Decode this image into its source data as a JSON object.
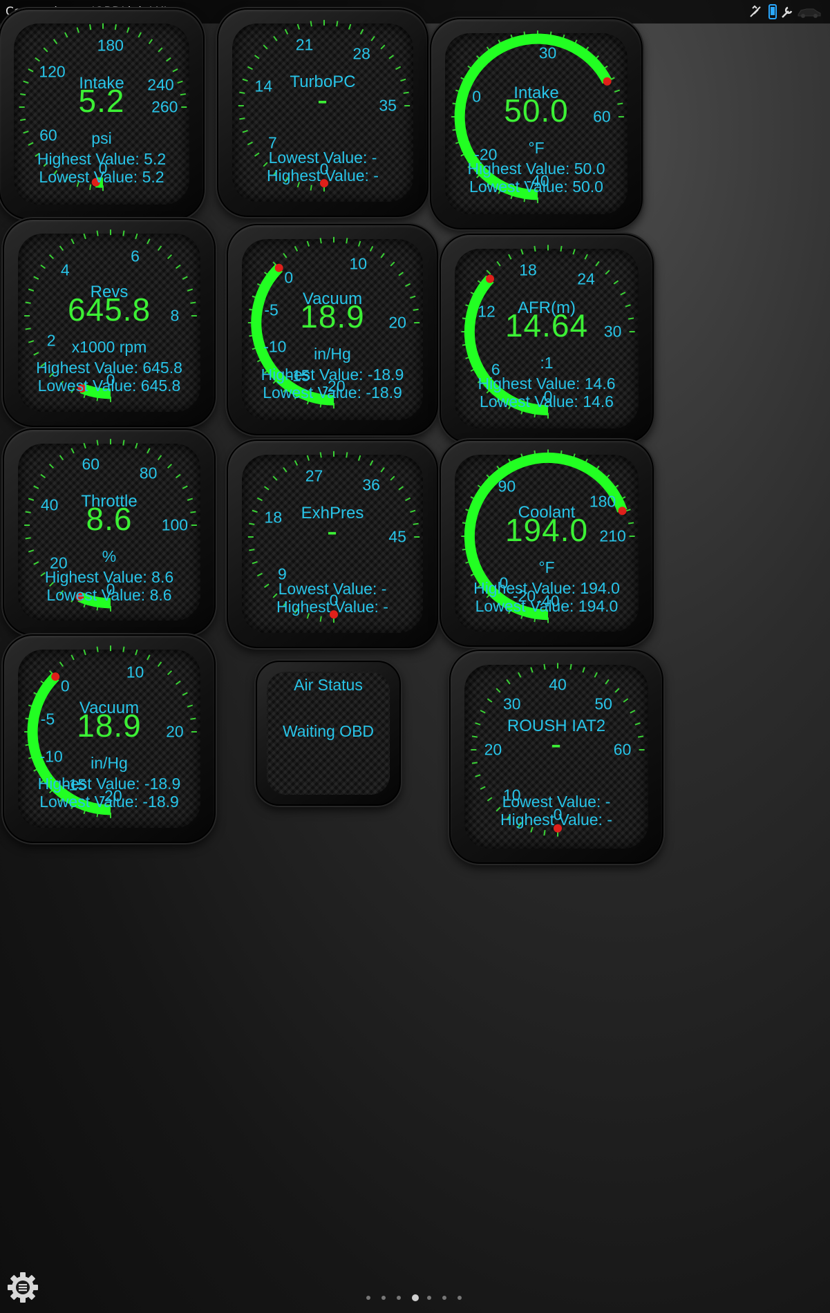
{
  "status_bar": {
    "text": "Connecting to 'OBDLink LX'",
    "icons": [
      "gps-icon",
      "phone-icon",
      "wrench-icon",
      "car-icon"
    ]
  },
  "gauges": [
    {
      "id": "intake-boost",
      "title": "Intake",
      "value": "5.2",
      "unit": "psi",
      "min": 0,
      "max": 260,
      "ticks": [
        "0",
        "60",
        "120",
        "180",
        "240",
        "260"
      ],
      "tick_values": [
        0,
        60,
        120,
        180,
        240,
        260
      ],
      "fill": 0.02,
      "stat1": "Highest Value: 5.2",
      "stat2": "Lowest Value: 5.2"
    },
    {
      "id": "turbopc",
      "title": "TurboPC",
      "value": "-",
      "unit": "",
      "min": 0,
      "max": 35,
      "ticks": [
        "0",
        "7",
        "14",
        "21",
        "28",
        "35"
      ],
      "tick_values": [
        0,
        7,
        14,
        21,
        28,
        35
      ],
      "fill": 0,
      "stat1": "Lowest Value: -",
      "stat2": "Highest Value: -"
    },
    {
      "id": "intake-temp",
      "title": "Intake",
      "value": "50.0",
      "unit": "°F",
      "min": -40,
      "max": 60,
      "ticks": [
        "-40",
        "-20",
        "0",
        "30",
        "60"
      ],
      "tick_values": [
        -40,
        -20,
        0,
        30,
        60
      ],
      "fill": 0.9,
      "stat1": "Highest Value: 50.0",
      "stat2": "Lowest Value: 50.0"
    },
    {
      "id": "revs",
      "title": "Revs",
      "value": "645.8",
      "unit": "x1000 rpm",
      "min": 0,
      "max": 8,
      "ticks": [
        "0",
        "2",
        "4",
        "6",
        "8"
      ],
      "tick_values": [
        0,
        2,
        4,
        6,
        8
      ],
      "fill": 0.08,
      "stat1": "Highest Value: 645.8",
      "stat2": "Lowest Value: 645.8"
    },
    {
      "id": "vacuum-1",
      "title": "Vacuum",
      "value": "18.9",
      "unit": "in/Hg",
      "min": -20,
      "max": 20,
      "ticks": [
        "-20",
        "-15",
        "-10",
        "-5",
        "0",
        "10",
        "20"
      ],
      "tick_values": [
        -20,
        -15,
        -10,
        -5,
        0,
        10,
        20
      ],
      "fill": 0.5,
      "stat1": "Highest Value: -18.9",
      "stat2": "Lowest Value: -18.9"
    },
    {
      "id": "afr",
      "title": "AFR(m)",
      "value": "14.64",
      "unit": ":1",
      "min": 0,
      "max": 30,
      "ticks": [
        "0",
        "6",
        "12",
        "18",
        "24",
        "30"
      ],
      "tick_values": [
        0,
        6,
        12,
        18,
        24,
        30
      ],
      "fill": 0.49,
      "stat1": "Highest Value: 14.6",
      "stat2": "Lowest Value: 14.6"
    },
    {
      "id": "throttle",
      "title": "Throttle",
      "value": "8.6",
      "unit": "%",
      "min": 0,
      "max": 100,
      "ticks": [
        "0",
        "20",
        "40",
        "60",
        "80",
        "100"
      ],
      "tick_values": [
        0,
        20,
        40,
        60,
        80,
        100
      ],
      "fill": 0.086,
      "stat1": "Highest Value: 8.6",
      "stat2": "Lowest Value: 8.6"
    },
    {
      "id": "exhpres",
      "title": "ExhPres",
      "value": "-",
      "unit": "",
      "min": 0,
      "max": 45,
      "ticks": [
        "0",
        "9",
        "18",
        "27",
        "36",
        "45"
      ],
      "tick_values": [
        0,
        9,
        18,
        27,
        36,
        45
      ],
      "fill": 0,
      "stat1": "Lowest Value: -",
      "stat2": "Highest Value: -"
    },
    {
      "id": "coolant",
      "title": "Coolant",
      "value": "194.0",
      "unit": "°F",
      "min": -40,
      "max": 210,
      "ticks": [
        "-40",
        "-20",
        "0",
        "90",
        "180",
        "210"
      ],
      "tick_values": [
        -40,
        -20,
        0,
        90,
        180,
        210
      ],
      "fill": 0.93,
      "stat1": "Highest Value: 194.0",
      "stat2": "Lowest Value: 194.0"
    },
    {
      "id": "vacuum-2",
      "title": "Vacuum",
      "value": "18.9",
      "unit": "in/Hg",
      "min": -20,
      "max": 20,
      "ticks": [
        "-20",
        "-15",
        "-10",
        "-5",
        "0",
        "10",
        "20"
      ],
      "tick_values": [
        -20,
        -15,
        -10,
        -5,
        0,
        10,
        20
      ],
      "fill": 0.5,
      "stat1": "Highest Value: -18.9",
      "stat2": "Lowest Value: -18.9"
    },
    {
      "id": "roush-iat2",
      "title": "ROUSH IAT2",
      "value": "-",
      "unit": "",
      "min": 0,
      "max": 60,
      "ticks": [
        "0",
        "10",
        "20",
        "30",
        "40",
        "50",
        "60"
      ],
      "tick_values": [
        0,
        10,
        20,
        30,
        40,
        50,
        60
      ],
      "fill": 0,
      "stat1": "Lowest Value: -",
      "stat2": "Highest Value: -"
    }
  ],
  "air_status": {
    "title": "Air Status",
    "value": "Waiting OBD"
  },
  "pager": {
    "count": 7,
    "active": 3
  },
  "colors": {
    "accent_text": "#28c4e8",
    "value_green": "#3cf035",
    "arc_green": "#22ff22",
    "needle_red": "#e0201a"
  }
}
